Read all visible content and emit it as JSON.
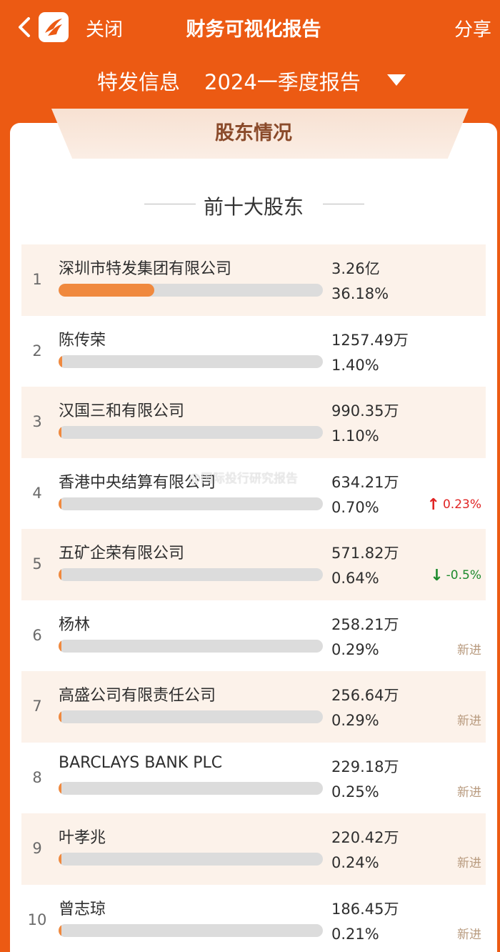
{
  "header": {
    "close_label": "关闭",
    "title": "财务可视化报告",
    "share_label": "分享"
  },
  "report": {
    "company": "特发信息",
    "period": "2024一季度报告"
  },
  "section": {
    "title": "股东情况",
    "subtitle": "前十大股东"
  },
  "shareholders": [
    {
      "rank": "1",
      "name": "深圳市特发集团有限公司",
      "shares": "3.26亿",
      "pct": "36.18%",
      "pct_value": 36.18,
      "change": ""
    },
    {
      "rank": "2",
      "name": "陈传荣",
      "shares": "1257.49万",
      "pct": "1.40%",
      "pct_value": 1.4,
      "change": ""
    },
    {
      "rank": "3",
      "name": "汉国三和有限公司",
      "shares": "990.35万",
      "pct": "1.10%",
      "pct_value": 1.1,
      "change": ""
    },
    {
      "rank": "4",
      "name": "香港中央结算有限公司",
      "shares": "634.21万",
      "pct": "0.70%",
      "pct_value": 0.7,
      "change": "0.23%",
      "change_type": "up"
    },
    {
      "rank": "5",
      "name": "五矿企荣有限公司",
      "shares": "571.82万",
      "pct": "0.64%",
      "pct_value": 0.64,
      "change": "-0.5%",
      "change_type": "down"
    },
    {
      "rank": "6",
      "name": "杨林",
      "shares": "258.21万",
      "pct": "0.29%",
      "pct_value": 0.29,
      "change": "新进",
      "change_type": "new"
    },
    {
      "rank": "7",
      "name": "高盛公司有限责任公司",
      "shares": "256.64万",
      "pct": "0.29%",
      "pct_value": 0.29,
      "change": "新进",
      "change_type": "new"
    },
    {
      "rank": "8",
      "name": "BARCLAYS BANK PLC",
      "shares": "229.18万",
      "pct": "0.25%",
      "pct_value": 0.25,
      "change": "新进",
      "change_type": "new"
    },
    {
      "rank": "9",
      "name": "叶孝兆",
      "shares": "220.42万",
      "pct": "0.24%",
      "pct_value": 0.24,
      "change": "新进",
      "change_type": "new"
    },
    {
      "rank": "10",
      "name": "曾志琼",
      "shares": "186.45万",
      "pct": "0.21%",
      "pct_value": 0.21,
      "change": "新进",
      "change_type": "new"
    }
  ],
  "watermark": "@国际投行研究报告",
  "colors": {
    "brand_orange": "#ec5a13",
    "bar_fill": "#f0893e",
    "bar_track": "#dcdcdc",
    "up": "#e02424",
    "down": "#1c8a2c",
    "new": "#b89a7e"
  }
}
